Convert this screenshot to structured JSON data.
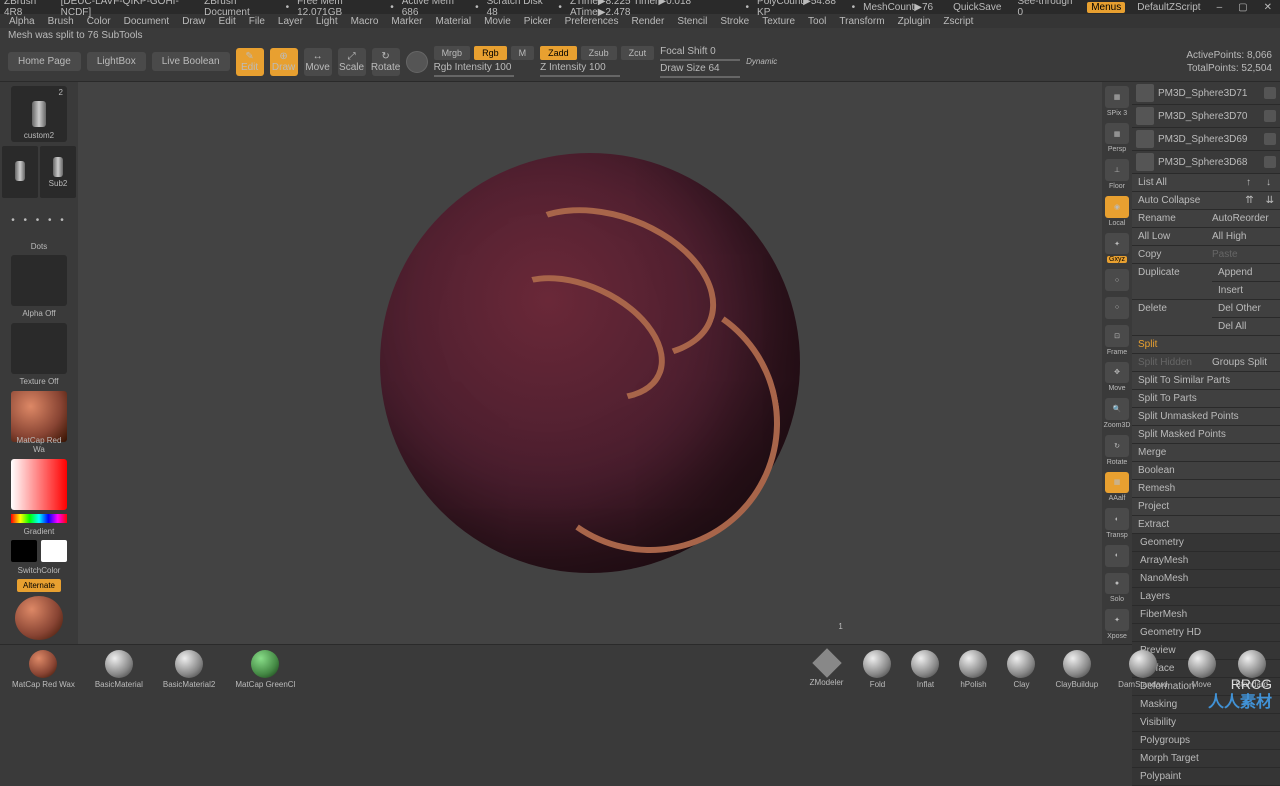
{
  "title": {
    "app": "ZBrush 4R8",
    "doc": "[DEUC-LAVF-QIKP-GOHI-NCDF]",
    "docname": "ZBrush Document",
    "freemem": "Free Mem 12.071GB",
    "activemem": "Active Mem 686",
    "scratch": "Scratch Disk 48",
    "ztime": "ZTime▶8.225 Timer▶0.018 ATime▶2.478",
    "polycount": "PolyCount▶54.88 KP",
    "meshcount": "MeshCount▶76",
    "quicksave": "QuickSave",
    "seethrough": "See-through  0",
    "menus": "Menus",
    "defaultz": "DefaultZScript"
  },
  "menu": [
    "Alpha",
    "Brush",
    "Color",
    "Document",
    "Draw",
    "Edit",
    "File",
    "Layer",
    "Light",
    "Macro",
    "Marker",
    "Material",
    "Movie",
    "Picker",
    "Preferences",
    "Render",
    "Stencil",
    "Stroke",
    "Texture",
    "Tool",
    "Transform",
    "Zplugin",
    "Zscript"
  ],
  "status": "Mesh was split to 76 SubTools",
  "topbar": {
    "home": "Home Page",
    "lightbox": "LightBox",
    "liveboolean": "Live Boolean",
    "edit": "Edit",
    "draw": "Draw",
    "move": "Move",
    "scale": "Scale",
    "rotate": "Rotate",
    "mrgb": "Mrgb",
    "rgb": "Rgb",
    "m": "M",
    "rgbint": "Rgb Intensity 100",
    "zadd": "Zadd",
    "zsub": "Zsub",
    "zcut": "Zcut",
    "zint": "Z Intensity 100",
    "focal": "Focal Shift 0",
    "drawsize": "Draw Size 64",
    "dynamic": "Dynamic",
    "activepoints": "ActivePoints: 8,066",
    "totalpoints": "TotalPoints: 52,504"
  },
  "left": {
    "tool1": "custom2",
    "tool1badge": "2",
    "tool2": "",
    "tool3": "Sub2",
    "dots": "Dots",
    "alpha": "Alpha Off",
    "texture": "Texture Off",
    "material": "MatCap Red Wa",
    "gradient": "Gradient",
    "switch": "SwitchColor",
    "alternate": "Alternate"
  },
  "righttools": {
    "spix": "SPix 3",
    "persp": "Persp",
    "floor": "Floor",
    "local": "Local",
    "gyz": "Gxyz",
    "frame": "Frame",
    "move": "Move",
    "zoom": "Zoom3D",
    "rotate": "Rotate",
    "aaalf": "AAalf",
    "transp": "Transp",
    "solo": "Solo",
    "xpose": "Xpose"
  },
  "subtools": [
    "PM3D_Sphere3D71",
    "PM3D_Sphere3D70",
    "PM3D_Sphere3D69",
    "PM3D_Sphere3D68"
  ],
  "panel": {
    "listall": "List All",
    "autocollapse": "Auto Collapse",
    "rename": "Rename",
    "autoreorder": "AutoReorder",
    "alllow": "All Low",
    "allhigh": "All High",
    "copy": "Copy",
    "paste": "Paste",
    "duplicate": "Duplicate",
    "append": "Append",
    "insert": "Insert",
    "delete": "Delete",
    "delother": "Del Other",
    "delall": "Del All",
    "split": "Split",
    "splithidden": "Split Hidden",
    "groupsplit": "Groups Split",
    "splitsimilar": "Split To Similar Parts",
    "splitparts": "Split To Parts",
    "splitunmasked": "Split Unmasked Points",
    "splitmasked": "Split Masked Points",
    "merge": "Merge",
    "boolean": "Boolean",
    "remesh": "Remesh",
    "project": "Project",
    "extract": "Extract"
  },
  "sections": [
    "Geometry",
    "ArrayMesh",
    "NanoMesh",
    "Layers",
    "FiberMesh",
    "Geometry HD",
    "Preview",
    "Surface",
    "Deformation",
    "Masking",
    "Visibility",
    "Polygroups",
    "Morph Target",
    "Polypaint"
  ],
  "bottom": {
    "mats": [
      "MatCap Red Wax",
      "BasicMaterial",
      "BasicMaterial2",
      "MatCap GreenCl"
    ],
    "brushes": [
      "ZModeler",
      "Fold",
      "Inflat",
      "hPolish",
      "Clay",
      "ClayBuildup",
      "DamStandard",
      "Move",
      "Standard"
    ],
    "badge": "1"
  },
  "watermark": "人人素材",
  "watermark2": "RRCG"
}
